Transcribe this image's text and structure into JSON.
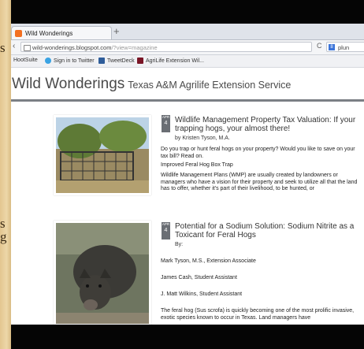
{
  "slide": {
    "left_text_1": "s",
    "left_text_2": "s",
    "left_text_3": "g"
  },
  "browser": {
    "tab_title": "Wild Wonderings",
    "new_tab_symbol": "+",
    "url_host": "wild-wonderings.blogspot.com",
    "url_path": "/?view=magazine",
    "reload_symbol": "C",
    "search_text": "plun",
    "bookmarks": [
      {
        "label": "HootSuite",
        "color": "#1c1c1c"
      },
      {
        "label": "Sign in to Twitter",
        "color": "#3aa3e3"
      },
      {
        "label": "TweetDeck",
        "color": "#2f5d9a"
      },
      {
        "label": "AgriLife Extension Wil...",
        "color": "#7a1526"
      }
    ]
  },
  "blog": {
    "title": "Wild Wonderings",
    "subtitle": "Texas A&M Agrilife Extension Service"
  },
  "posts": [
    {
      "badge_month": "APR",
      "badge_day": "4",
      "title": "Wildlife Management Property Tax Valuation: If your trapping hogs, your almost there!",
      "byline": "by Kristen Tyson, M.A.",
      "paragraphs": [
        "Do you trap or hunt feral hogs on your property? Would you like to save on your tax bill? Read on.",
        "Improved Feral Hog Box Trap",
        "Wildlife Management Plans (WMP) are usually created by landowners or managers who have a vision for their property and seek to utilize all that the land has to offer, whether it's part of their livelihood, to be hunted, or"
      ]
    },
    {
      "badge_month": "APR",
      "badge_day": "4",
      "title": "Potential for a Sodium Solution: Sodium Nitrite as a Toxicant for Feral Hogs",
      "byline": "By:",
      "paragraphs": [
        "Mark Tyson, M.S., Extension Associate",
        "James Cash, Student Assistant",
        "J. Matt Wilkins, Student Assistant",
        "The feral hog (Sus scrofa) is quickly becoming one of the most prolific invasive, exotic species known to occur in Texas. Land managers have"
      ]
    }
  ],
  "colors": {
    "accent_orange": "#f37021",
    "header_rule": "#7b7f85",
    "badge": "#6a6e74"
  }
}
